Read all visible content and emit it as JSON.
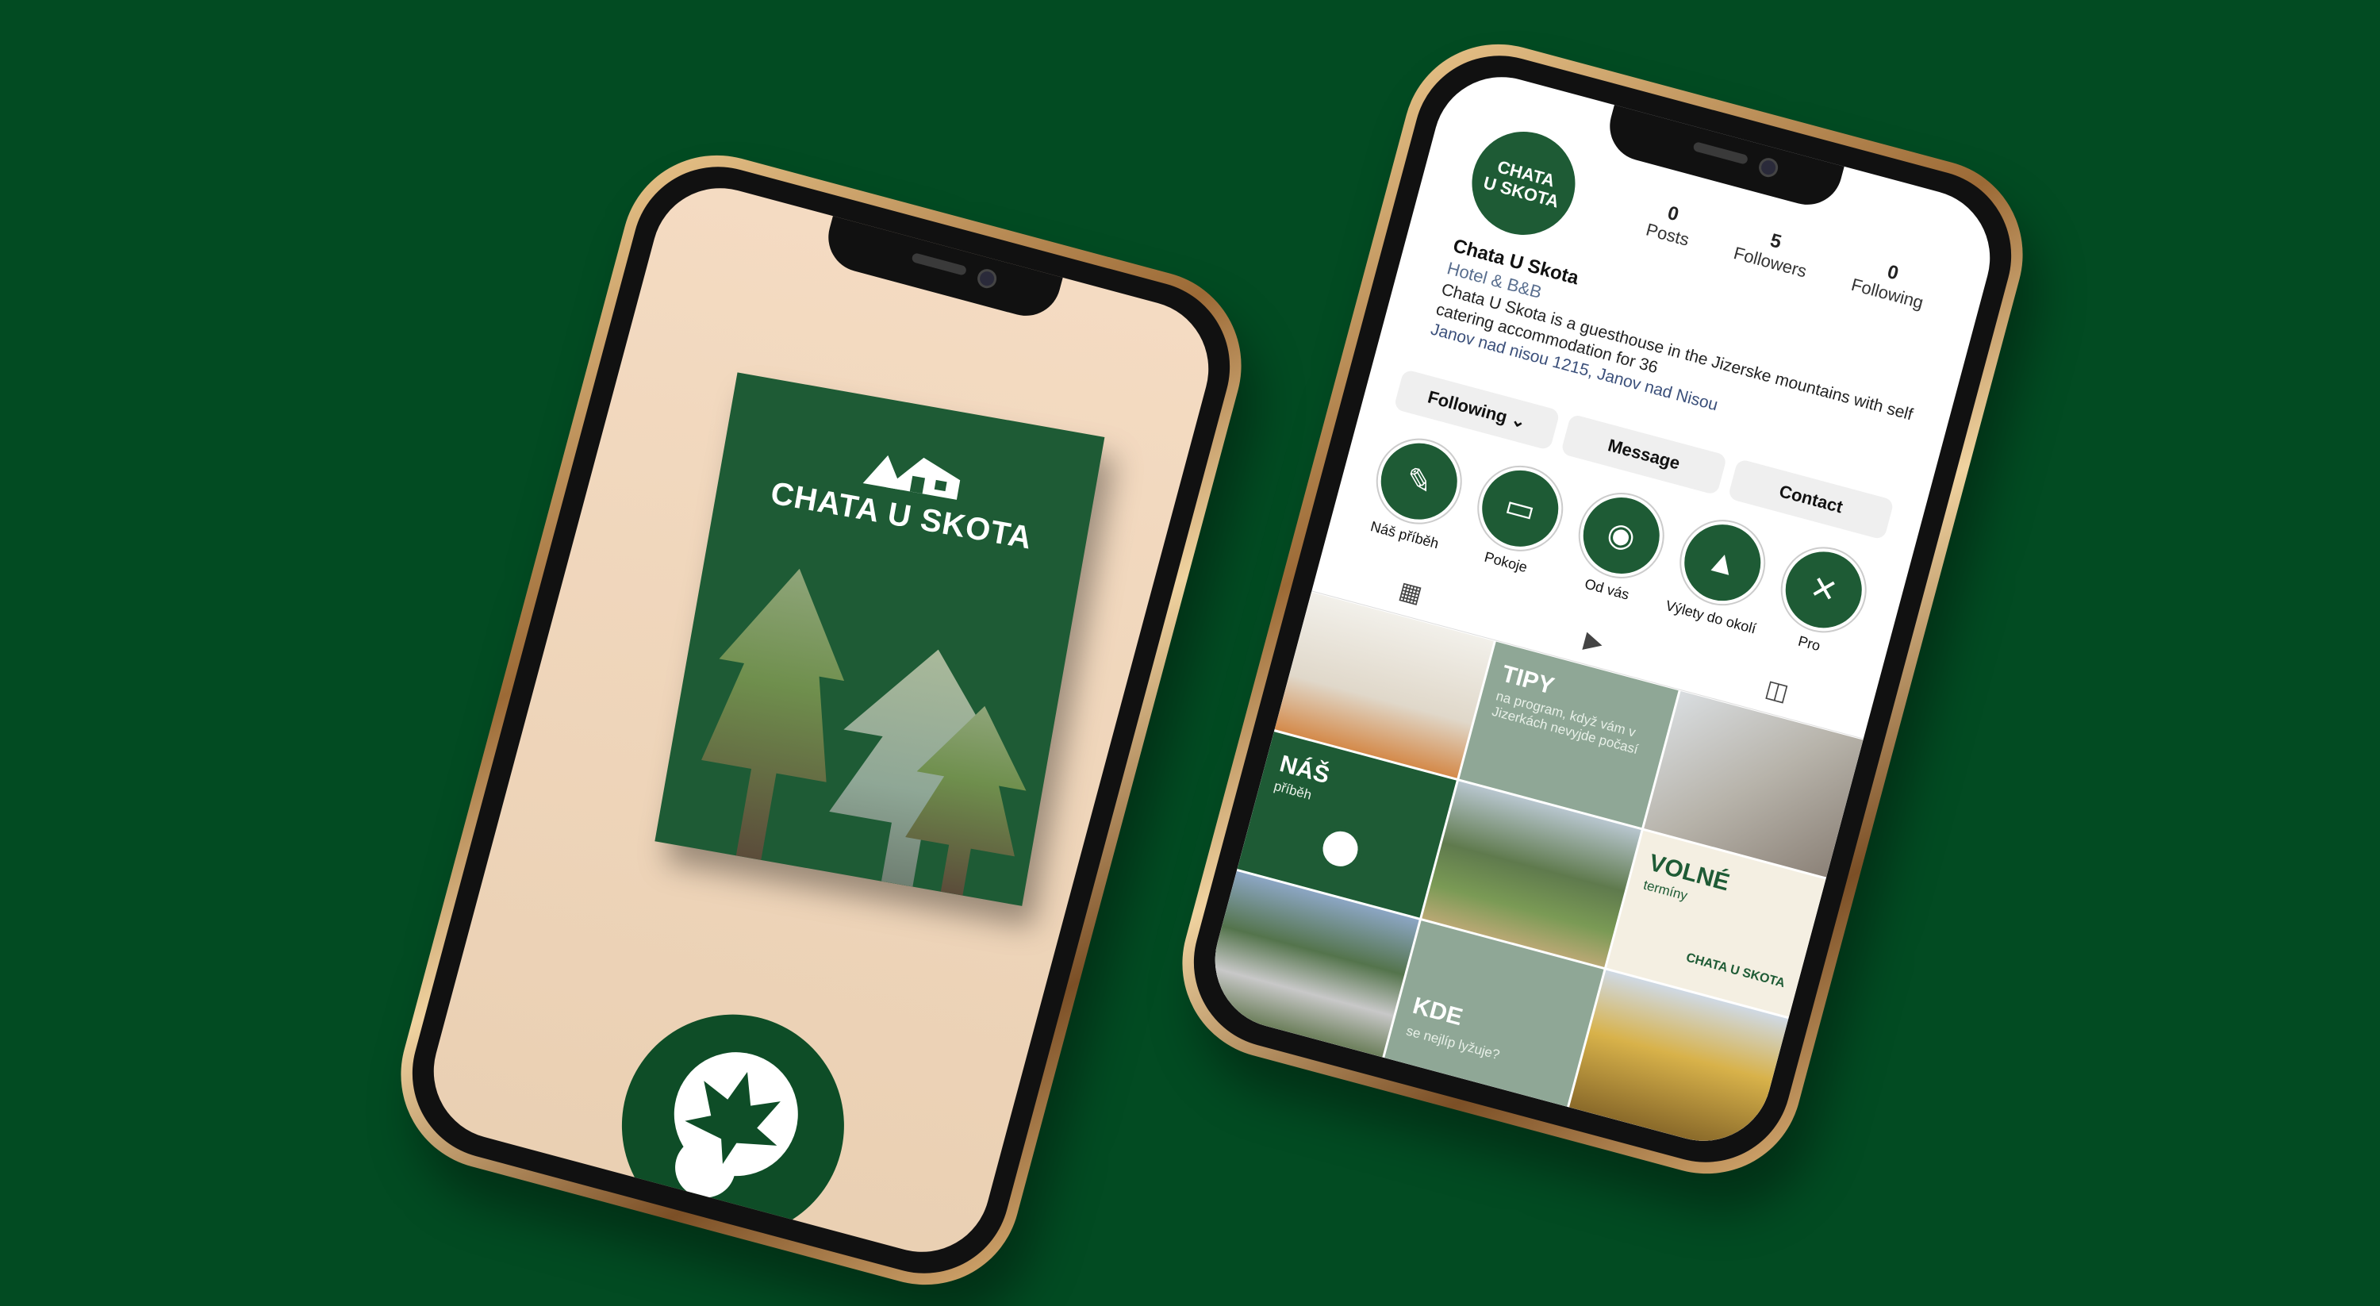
{
  "colors": {
    "background": "#024b22",
    "brand_green": "#1e5b35",
    "sage": "#8fa796",
    "cream": "#f4efe2",
    "phone_frame": "#c79a5e"
  },
  "left_phone": {
    "brochure_title": "CHATA U SKOTA",
    "logo_icon": "leaf-pin-icon"
  },
  "right_phone": {
    "profile": {
      "avatar_line1": "CHATA",
      "avatar_line2": "U SKOTA",
      "name": "Chata U Skota",
      "category": "Hotel & B&B",
      "bio": "Chata U Skota is a guesthouse in the Jizerske mountains with self catering accommodation for 36",
      "address": "Janov nad nisou 1215, Janov nad Nisou"
    },
    "stats": [
      {
        "num": "0",
        "label": "Posts"
      },
      {
        "num": "5",
        "label": "Followers"
      },
      {
        "num": "0",
        "label": "Following"
      }
    ],
    "buttons": {
      "following": "Following ⌄",
      "message": "Message",
      "contact": "Contact"
    },
    "highlights": [
      {
        "label": "Náš příběh",
        "icon": "notepad-icon"
      },
      {
        "label": "Pokoje",
        "icon": "bed-icon"
      },
      {
        "label": "Od vás",
        "icon": "camera-icon"
      },
      {
        "label": "Výlety do okolí",
        "icon": "tree-icon"
      },
      {
        "label": "Pro",
        "icon": "tools-icon"
      }
    ],
    "tabs": [
      "grid-icon",
      "reels-icon",
      "tagged-icon"
    ],
    "tiles": {
      "tipy_title": "TIPY",
      "tipy_sub": "na program, když vám v Jizerkách nevyjde počasí",
      "nas_title": "NÁŠ",
      "nas_sub": "příběh",
      "volne_title": "VOLNÉ",
      "volne_sub": "termíny",
      "volne_logo": "CHATA U SKOTA",
      "kde_title": "KDE",
      "kde_sub": "se nejlíp lyžuje?"
    }
  }
}
